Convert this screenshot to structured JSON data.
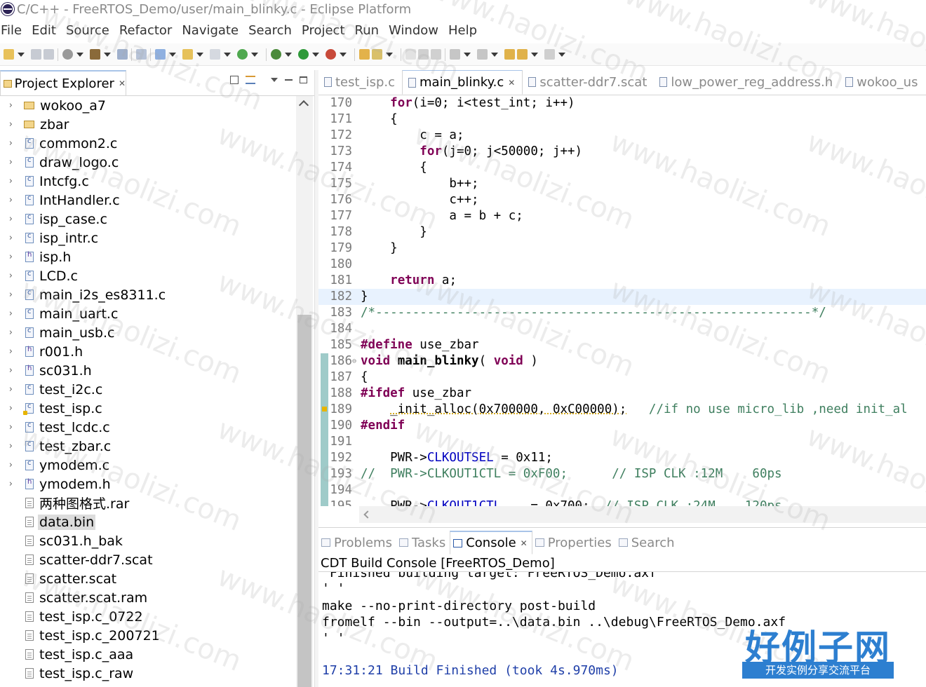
{
  "window": {
    "title": "C/C++ - FreeRTOS_Demo/user/main_blinky.c - Eclipse Platform"
  },
  "menu": [
    "File",
    "Edit",
    "Source",
    "Refactor",
    "Navigate",
    "Search",
    "Project",
    "Run",
    "Window",
    "Help"
  ],
  "project_explorer": {
    "tab_label": "Project Explorer",
    "items": [
      {
        "name": "wokoo_a7",
        "type": "folder",
        "expandable": true
      },
      {
        "name": "zbar",
        "type": "folder",
        "expandable": true
      },
      {
        "name": "common2.c",
        "type": "c",
        "expandable": true
      },
      {
        "name": "draw_logo.c",
        "type": "c",
        "expandable": true
      },
      {
        "name": "Intcfg.c",
        "type": "c",
        "expandable": true
      },
      {
        "name": "IntHandler.c",
        "type": "c",
        "expandable": true
      },
      {
        "name": "isp_case.c",
        "type": "c",
        "expandable": true
      },
      {
        "name": "isp_intr.c",
        "type": "c",
        "expandable": true
      },
      {
        "name": "isp.h",
        "type": "h",
        "expandable": true
      },
      {
        "name": "LCD.c",
        "type": "c",
        "expandable": true
      },
      {
        "name": "main_i2s_es8311.c",
        "type": "c",
        "expandable": true
      },
      {
        "name": "main_uart.c",
        "type": "c",
        "expandable": true
      },
      {
        "name": "main_usb.c",
        "type": "c",
        "expandable": true
      },
      {
        "name": "r001.h",
        "type": "h",
        "expandable": true
      },
      {
        "name": "sc031.h",
        "type": "h",
        "expandable": true
      },
      {
        "name": "test_i2c.c",
        "type": "c",
        "expandable": true
      },
      {
        "name": "test_isp.c",
        "type": "c-warn",
        "expandable": true
      },
      {
        "name": "test_lcdc.c",
        "type": "c",
        "expandable": true
      },
      {
        "name": "test_zbar.c",
        "type": "c",
        "expandable": true
      },
      {
        "name": "ymodem.c",
        "type": "c",
        "expandable": true
      },
      {
        "name": "ymodem.h",
        "type": "h",
        "expandable": true
      },
      {
        "name": "两种图格式.rar",
        "type": "plain",
        "expandable": false
      },
      {
        "name": "data.bin",
        "type": "plain",
        "expandable": false,
        "selected": true
      },
      {
        "name": "sc031.h_bak",
        "type": "plain",
        "expandable": false
      },
      {
        "name": "scatter-ddr7.scat",
        "type": "plain",
        "expandable": false
      },
      {
        "name": "scatter.scat",
        "type": "plain",
        "expandable": false
      },
      {
        "name": "scatter.scat.ram",
        "type": "plain",
        "expandable": false
      },
      {
        "name": "test_isp.c_0722",
        "type": "plain",
        "expandable": false
      },
      {
        "name": "test_isp.c_200721",
        "type": "plain",
        "expandable": false
      },
      {
        "name": "test_isp.c_aaa",
        "type": "plain",
        "expandable": false
      },
      {
        "name": "test_isp.c_raw",
        "type": "plain",
        "expandable": false
      }
    ]
  },
  "editor": {
    "tabs": [
      {
        "label": "test_isp.c",
        "active": false
      },
      {
        "label": "main_blinky.c",
        "active": true
      },
      {
        "label": "scatter-ddr7.scat",
        "active": false
      },
      {
        "label": "low_power_reg_address.h",
        "active": false
      },
      {
        "label": "wokoo_us",
        "active": false
      }
    ],
    "lines": [
      {
        "n": "170",
        "html": "    <span class=\"kw\">for</span>(i=0; i&lt;test_int; i++)"
      },
      {
        "n": "171",
        "html": "    {"
      },
      {
        "n": "172",
        "html": "        c = a;"
      },
      {
        "n": "173",
        "html": "        <span class=\"kw\">for</span>(j=0; j&lt;50000; j++)"
      },
      {
        "n": "174",
        "html": "        {"
      },
      {
        "n": "175",
        "html": "            b++;"
      },
      {
        "n": "176",
        "html": "            c++;"
      },
      {
        "n": "177",
        "html": "            a = b + c;"
      },
      {
        "n": "178",
        "html": "        }"
      },
      {
        "n": "179",
        "html": "    }"
      },
      {
        "n": "180",
        "html": ""
      },
      {
        "n": "181",
        "html": "    <span class=\"kw\">return</span> a;"
      },
      {
        "n": "182",
        "html": "}",
        "current": true
      },
      {
        "n": "183",
        "html": "<span class=\"cm\">/*-----------------------------------------------------------*/</span>"
      },
      {
        "n": "184",
        "html": ""
      },
      {
        "n": "185",
        "html": "<span class=\"kw\">#define</span> use_zbar"
      },
      {
        "n": "186",
        "html": "<span class=\"kw\">void</span> <b>main_blinky</b>( <span class=\"kw\">void</span> )",
        "fold": true
      },
      {
        "n": "187",
        "html": "{"
      },
      {
        "n": "188",
        "html": "<span class=\"kw\">#ifdef</span> use_zbar"
      },
      {
        "n": "189",
        "html": "    <span class=\"under\">_init_alloc(0x700000, 0xC00000);</span>   <span class=\"cm\">//if no use micro_lib ,need init_al</span>"
      },
      {
        "n": "190",
        "html": "<span class=\"kw\">#endif</span>"
      },
      {
        "n": "191",
        "html": ""
      },
      {
        "n": "192",
        "html": "    PWR-&gt;<span class=\"mac\">CLKOUTSEL</span> = 0x11;"
      },
      {
        "n": "193",
        "html": "<span class=\"cm\">//  PWR-&gt;CLKOUT1CTL = 0xF00;      // ISP CLK :12M    60ps</span>"
      },
      {
        "n": "194",
        "html": ""
      },
      {
        "n": "195",
        "html": "    PWR-&gt;<span class=\"mac\">CLKOUT1CTL</span>    = 0x700;  <span class=\"cm\">// ISP CLK :24M    120ps</span>"
      }
    ]
  },
  "bottom_panel": {
    "tabs": [
      {
        "label": "Problems",
        "active": false
      },
      {
        "label": "Tasks",
        "active": false
      },
      {
        "label": "Console",
        "active": true
      },
      {
        "label": "Properties",
        "active": false
      },
      {
        "label": "Search",
        "active": false
      }
    ],
    "console_title": "CDT Build Console [FreeRTOS_Demo]",
    "console_lines": [
      "'Finished building target: FreeRTOS_Demo.axf'",
      "' '",
      "make --no-print-directory post-build",
      "fromelf --bin --output=..\\data.bin ..\\debug\\FreeRTOS_Demo.axf",
      "' '",
      "",
      "17:31:21 Build Finished (took 4s.970ms)"
    ]
  },
  "watermark": {
    "text": "www.haolizi.com",
    "logo_main": "好例子网",
    "logo_sub": "开发实例分享交流平台"
  }
}
